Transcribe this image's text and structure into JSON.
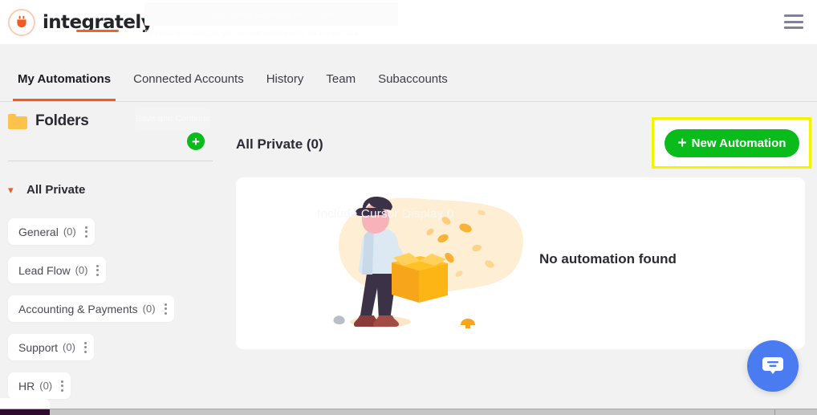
{
  "header": {
    "brand_name": "integrately",
    "logo_icon": "plug-icon",
    "menu_icon": "hamburger-menu-icon",
    "ghost_button_label": "Add new Google Account",
    "ghost_subtext": "By clicking on Google, you are authorizing us to fetch your data"
  },
  "tabs": [
    {
      "label": "My Automations",
      "active": true
    },
    {
      "label": "Connected Accounts",
      "active": false
    },
    {
      "label": "History",
      "active": false
    },
    {
      "label": "Team",
      "active": false
    },
    {
      "label": "Subaccounts",
      "active": false
    }
  ],
  "sidebar": {
    "title": "Folders",
    "folder_icon": "folder-icon",
    "add_button_label": "+",
    "ghost_save_label": "Save and Continue",
    "group": {
      "label": "All Private",
      "chevron_icon": "chevron-down-icon",
      "expanded": true
    },
    "items": [
      {
        "name": "General",
        "count": "(0)"
      },
      {
        "name": "Lead Flow",
        "count": "(0)"
      },
      {
        "name": "Accounting & Payments",
        "count": "(0)"
      },
      {
        "name": "Support",
        "count": "(0)"
      },
      {
        "name": "HR",
        "count": "(0)"
      }
    ]
  },
  "main": {
    "title": "All Private (0)",
    "new_automation_label": "New Automation",
    "new_automation_plus": "+",
    "empty_state_message": "No automation found",
    "empty_state_illustration": "person-holding-open-box-illustration",
    "ghost_dialog_text": "Include Cursor Display  0"
  },
  "chat": {
    "icon": "chat-bubble-icon"
  },
  "colors": {
    "brand_orange": "#f4591f",
    "accent_green": "#09bc1c",
    "highlight_yellow": "#f2f500",
    "chat_blue": "#4a7bf0",
    "folder_yellow": "#fcc24c",
    "page_background": "#f2f2f2"
  }
}
